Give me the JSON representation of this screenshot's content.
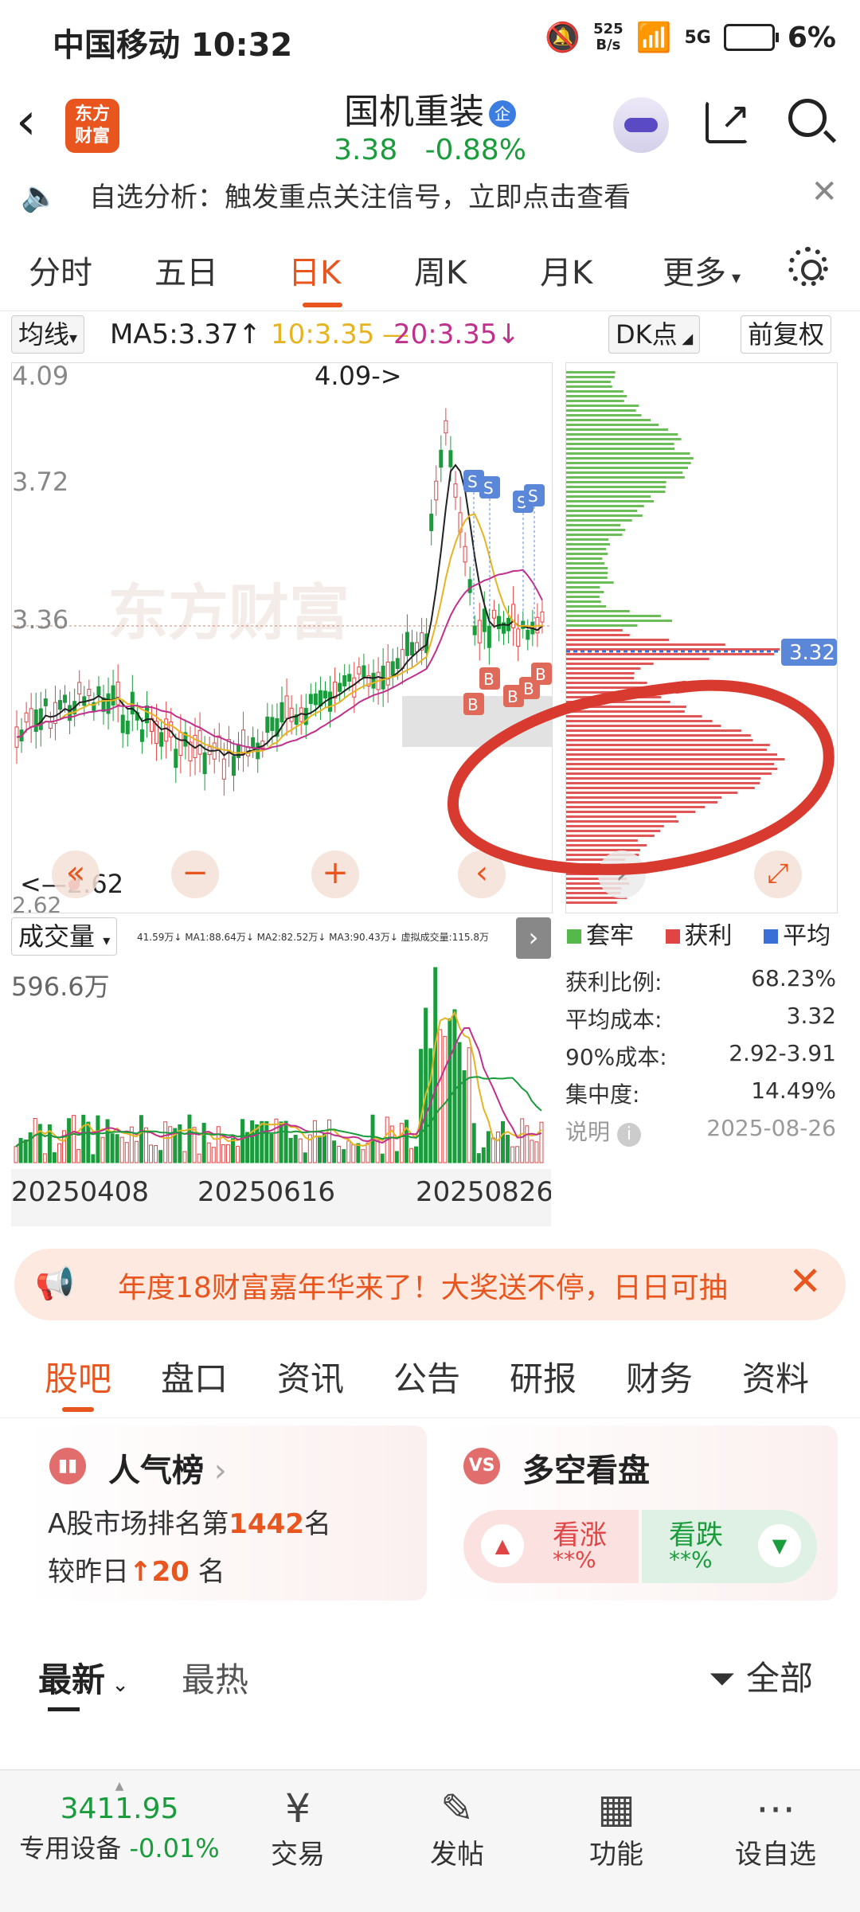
{
  "status": {
    "carrier_time": "中国移动 10:32",
    "netspeed_top": "525",
    "netspeed_bottom": "B/s",
    "net": "5G",
    "battery": "6%"
  },
  "header": {
    "logo_top": "东方",
    "logo_bottom": "财富",
    "name": "国机重装",
    "zq": "企",
    "price": "3.38",
    "change": "-0.88%"
  },
  "notice": {
    "text": "自选分析：触发重点关注信号，立即点击查看"
  },
  "tabs": [
    "分时",
    "五日",
    "日K",
    "周K",
    "月K",
    "更多"
  ],
  "ma": {
    "selector": "均线",
    "ma5": "MA5:3.37",
    "ma10": "10:3.35",
    "ma20": "20:3.35",
    "dk": "DK点",
    "fq": "前复权"
  },
  "kline": {
    "y_labels": [
      "4.09",
      "3.72",
      "3.36"
    ],
    "max_label": "4.09->",
    "min_label": "<—2.62",
    "min_axis": "2.62",
    "watermark": "东方财富"
  },
  "chips": {
    "avg_label": "3.32"
  },
  "volume": {
    "selector": "成交量",
    "ma_line": "41.59万↓  MA1:88.64万↓  MA2:82.52万↓  MA3:90.43万↓  虚拟成交量:115.8万",
    "max_label": "596.6万",
    "dates": [
      "20250408",
      "20250616",
      "20250826"
    ]
  },
  "legend": {
    "taolao": "套牢",
    "huoli": "获利",
    "pingjun": "平均"
  },
  "stats": [
    {
      "k": "获利比例:",
      "v": "68.23%"
    },
    {
      "k": "平均成本:",
      "v": "3.32"
    },
    {
      "k": "90%成本:",
      "v": "2.92-3.91"
    },
    {
      "k": "集中度:",
      "v": "14.49%"
    }
  ],
  "explain": {
    "label": "说明",
    "date": "2025-08-26"
  },
  "promo": {
    "text": "年度18财富嘉年华来了！大奖送不停，日日可抽"
  },
  "subtabs": [
    "股吧",
    "盘口",
    "资讯",
    "公告",
    "研报",
    "财务",
    "资料"
  ],
  "rank_card": {
    "title": "人气榜",
    "line1_a": "A股市场排名第",
    "line1_num": "1442",
    "line1_b": "名",
    "line2_a": "较昨日",
    "line2_num": "20",
    "line2_b": "名"
  },
  "vote_card": {
    "title": "多空看盘",
    "up": "看涨",
    "down": "看跌",
    "pct": "**%"
  },
  "sort": {
    "latest": "最新",
    "hot": "最热",
    "filter": "全部"
  },
  "bottom": {
    "index_value": "3411.95",
    "index_name": "专用设备",
    "index_change": "-0.01%",
    "items": [
      "交易",
      "发帖",
      "功能",
      "设自选"
    ]
  },
  "colors": {
    "accent": "#e8551e",
    "up": "#e04545",
    "down": "#1a9b3c",
    "avg": "#3b6fd8"
  }
}
